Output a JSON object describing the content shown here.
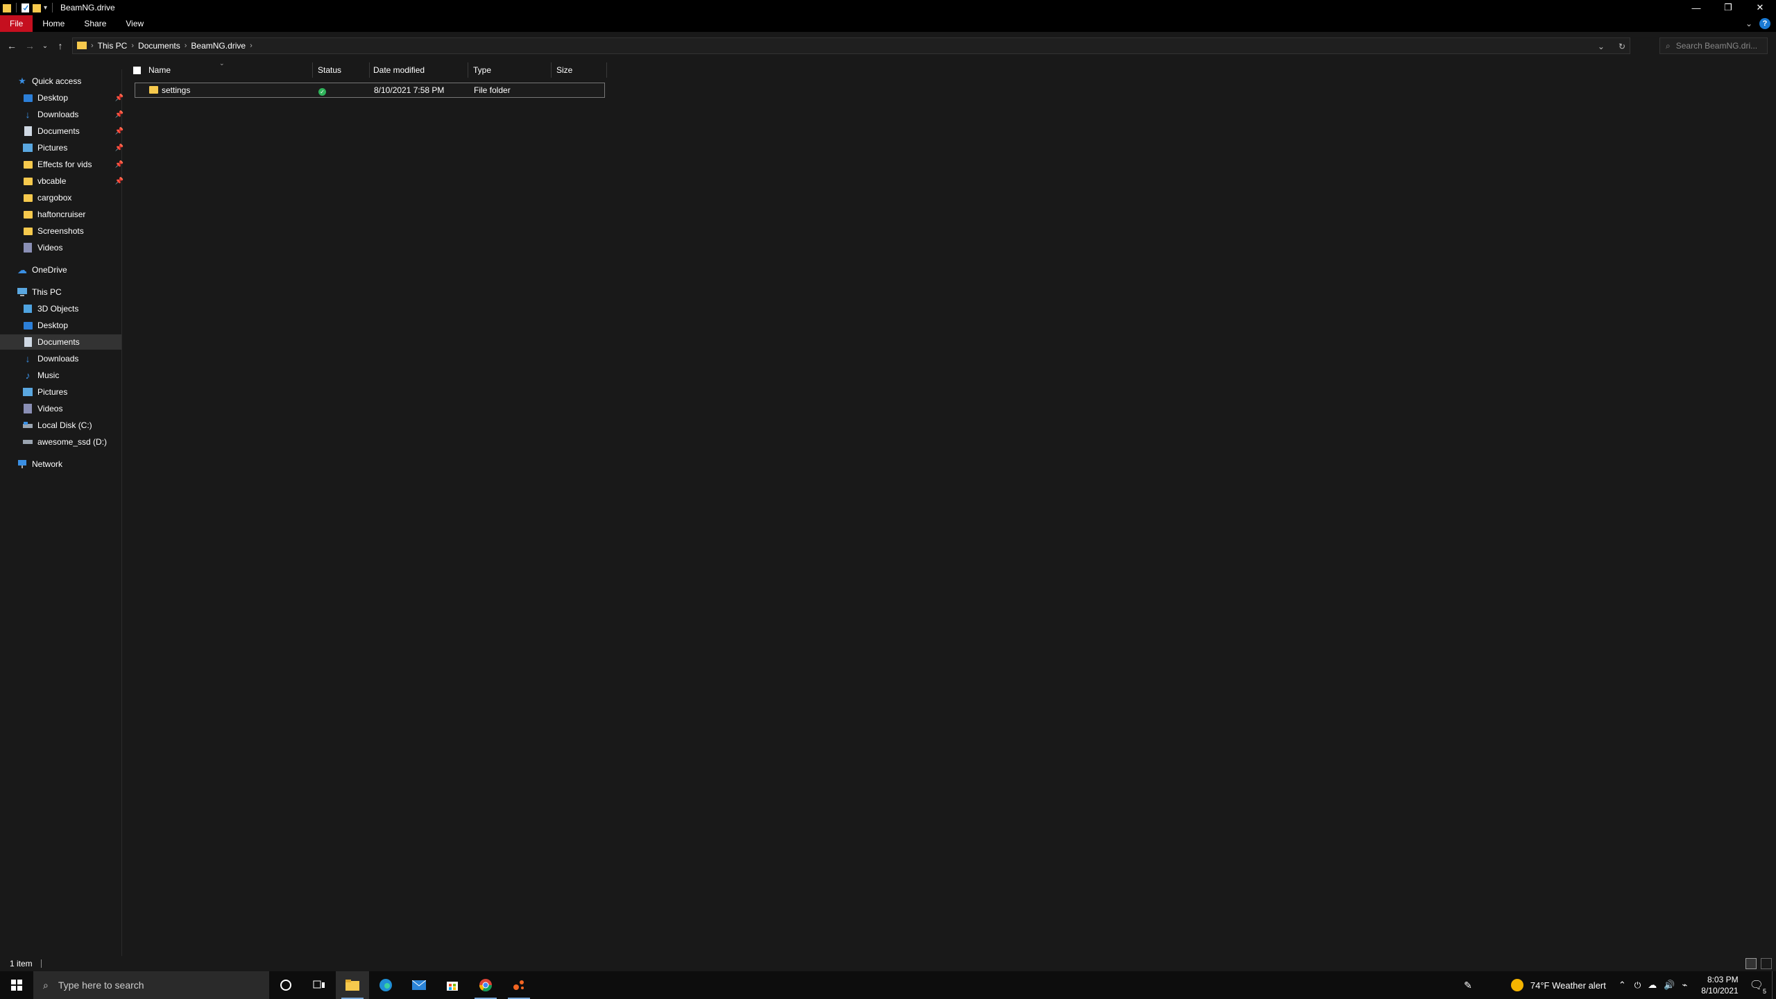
{
  "window": {
    "title": "BeamNG.drive",
    "minimize": "—",
    "restore": "❐",
    "close": "✕"
  },
  "ribbon": {
    "tabs": [
      "File",
      "Home",
      "Share",
      "View"
    ]
  },
  "address": {
    "crumbs": [
      "This PC",
      "Documents",
      "BeamNG.drive"
    ],
    "search_placeholder": "Search BeamNG.dri..."
  },
  "sidebar": {
    "quick_access": "Quick access",
    "quick_items": [
      {
        "label": "Desktop",
        "icon": "desktop-folder-icon",
        "pinned": true
      },
      {
        "label": "Downloads",
        "icon": "downloads-icon",
        "pinned": true
      },
      {
        "label": "Documents",
        "icon": "documents-icon",
        "pinned": true
      },
      {
        "label": "Pictures",
        "icon": "pictures-icon",
        "pinned": true
      },
      {
        "label": "Effects for vids",
        "icon": "folder-icon",
        "pinned": true
      },
      {
        "label": "vbcable",
        "icon": "folder-icon",
        "pinned": true
      },
      {
        "label": "cargobox",
        "icon": "folder-icon",
        "pinned": false
      },
      {
        "label": "haftoncruiser",
        "icon": "folder-icon",
        "pinned": false
      },
      {
        "label": "Screenshots",
        "icon": "folder-icon",
        "pinned": false
      },
      {
        "label": "Videos",
        "icon": "videos-icon",
        "pinned": false
      }
    ],
    "onedrive": "OneDrive",
    "this_pc": "This PC",
    "pc_items": [
      {
        "label": "3D Objects",
        "icon": "3d-objects-icon"
      },
      {
        "label": "Desktop",
        "icon": "desktop-folder-icon"
      },
      {
        "label": "Documents",
        "icon": "documents-icon",
        "selected": true
      },
      {
        "label": "Downloads",
        "icon": "downloads-icon"
      },
      {
        "label": "Music",
        "icon": "music-icon"
      },
      {
        "label": "Pictures",
        "icon": "pictures-icon"
      },
      {
        "label": "Videos",
        "icon": "videos-icon"
      },
      {
        "label": "Local Disk (C:)",
        "icon": "local-disk-icon"
      },
      {
        "label": "awesome_ssd (D:)",
        "icon": "drive-icon"
      }
    ],
    "network": "Network"
  },
  "columns": {
    "name": "Name",
    "status": "Status",
    "date_modified": "Date modified",
    "type": "Type",
    "size": "Size"
  },
  "files": [
    {
      "name": "settings",
      "status": "synced",
      "date_modified": "8/10/2021 7:58 PM",
      "type": "File folder",
      "size": ""
    }
  ],
  "statusbar": {
    "count": "1 item"
  },
  "taskbar": {
    "search_placeholder": "Type here to search",
    "weather": "74°F  Weather alert",
    "time": "8:03 PM",
    "date": "8/10/2021",
    "notifications": "5"
  },
  "colors": {
    "accent_file_tab": "#c50f1f",
    "folder": "#f6c94d",
    "status_ok": "#2fb35a"
  }
}
